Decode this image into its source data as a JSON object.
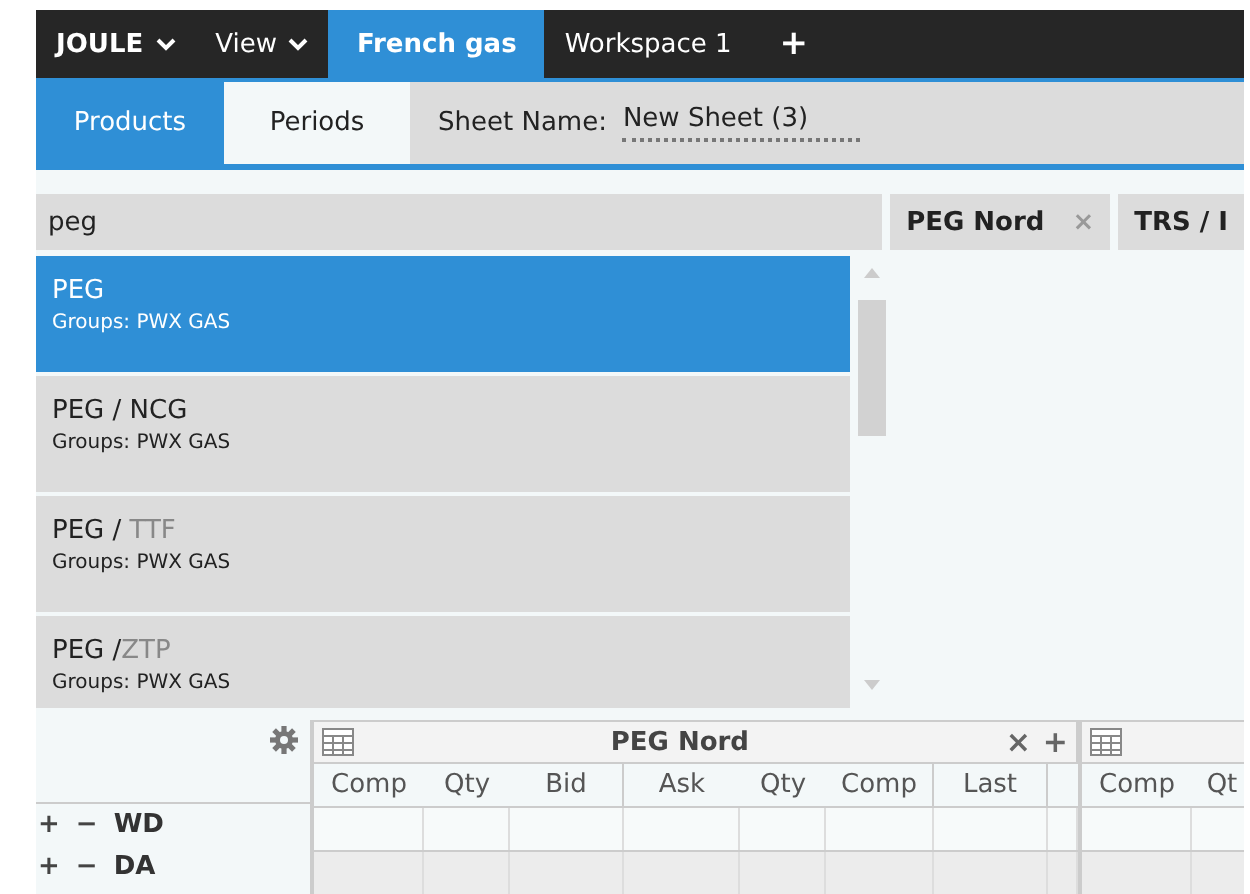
{
  "top_bar": {
    "menus": [
      {
        "label": "JOULE",
        "kind": "brand"
      },
      {
        "label": "View",
        "kind": "menu"
      }
    ],
    "tabs": [
      {
        "label": "French gas",
        "selected": true
      },
      {
        "label": "Workspace 1",
        "selected": false
      }
    ],
    "add_label": "+"
  },
  "sub_bar": {
    "tabs": [
      {
        "label": "Products",
        "selected": true
      },
      {
        "label": "Periods",
        "selected": false
      }
    ],
    "sheet_label": "Sheet Name:",
    "sheet_value": "New Sheet (3)"
  },
  "search": {
    "value": "peg"
  },
  "chips": [
    {
      "label": "PEG Nord",
      "close_label": "×"
    },
    {
      "label": "TRS / I"
    }
  ],
  "products": [
    {
      "name": "PEG",
      "groups": "Groups: PWX GAS",
      "selected": true
    },
    {
      "name": "PEG / NCG",
      "groups": "Groups: PWX GAS",
      "selected": false
    },
    {
      "name": "PEG / ",
      "dim_part": "TTF",
      "groups": "Groups: PWX GAS",
      "selected": false
    },
    {
      "name": "PEG /",
      "dim_part": "ZTP",
      "groups": "Groups: PWX GAS",
      "selected": false
    }
  ],
  "grids": [
    {
      "title": "PEG Nord",
      "columns": [
        "Comp",
        "Qty",
        "Bid",
        "Ask",
        "Qty",
        "Comp",
        "Last",
        null
      ],
      "close_label": "×",
      "add_label": "+"
    },
    {
      "columns": [
        "Comp",
        "Qt"
      ]
    }
  ],
  "rows": [
    {
      "label": "WD",
      "expand_label": "+",
      "collapse_label": "−"
    },
    {
      "label": "DA",
      "expand_label": "+",
      "collapse_label": "−"
    }
  ]
}
